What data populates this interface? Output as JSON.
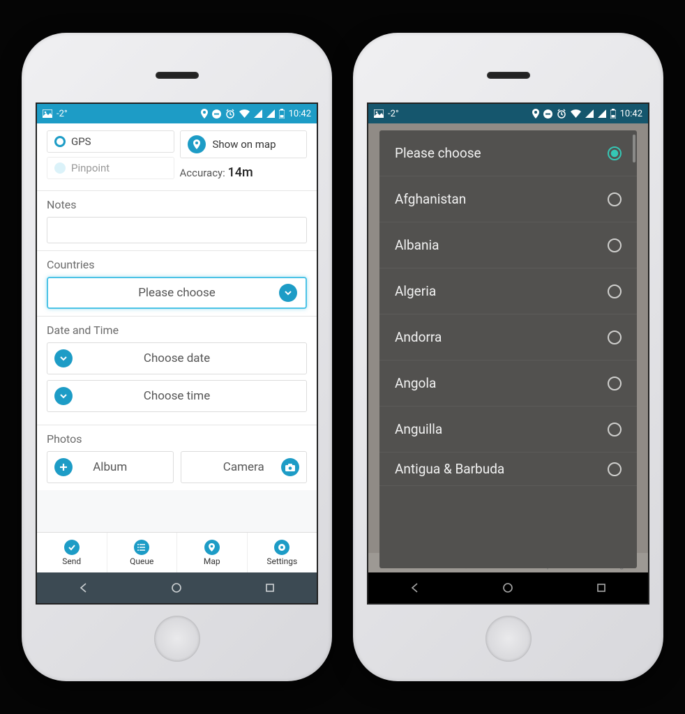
{
  "status": {
    "temp": "-2°",
    "time": "10:42"
  },
  "location": {
    "gps_label": "GPS",
    "pinpoint_label": "Pinpoint",
    "show_on_map": "Show on map",
    "accuracy_label": "Accuracy:",
    "accuracy_value": "14m"
  },
  "notes": {
    "label": "Notes"
  },
  "countries": {
    "label": "Countries",
    "placeholder": "Please choose",
    "options": [
      "Please choose",
      "Afghanistan",
      "Albania",
      "Algeria",
      "Andorra",
      "Angola",
      "Anguilla",
      "Antigua & Barbuda"
    ],
    "selected_index": 0
  },
  "datetime": {
    "label": "Date and Time",
    "choose_date": "Choose date",
    "choose_time": "Choose time"
  },
  "photos": {
    "label": "Photos",
    "album": "Album",
    "camera": "Camera"
  },
  "tabs": {
    "send": "Send",
    "queue": "Queue",
    "map": "Map",
    "settings": "Settings"
  },
  "colors": {
    "accent": "#1d9cc6"
  }
}
